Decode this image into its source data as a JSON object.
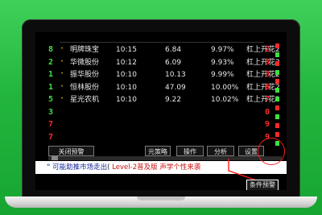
{
  "left_column": [
    "8",
    "2",
    "1",
    "1",
    "5",
    "3",
    "7",
    "7"
  ],
  "right_column": [
    "2",
    "3",
    "3",
    "6",
    "7",
    "0",
    "9",
    "9"
  ],
  "alerts": [
    {
      "name": "明牌珠宝",
      "time": "10:15",
      "price": "6.84",
      "pct": "9.97%",
      "signal": "杠上开花2"
    },
    {
      "name": "华微股份",
      "time": "10:12",
      "price": "6.09",
      "pct": "9.93%",
      "signal": "杠上开花2"
    },
    {
      "name": "振华股份",
      "time": "10:10",
      "price": "10.13",
      "pct": "9.99%",
      "signal": "杠上开花2"
    },
    {
      "name": "恒林股份",
      "time": "10:10",
      "price": "47.09",
      "pct": "10.00%",
      "signal": "杠上开花2"
    },
    {
      "name": "星光农机",
      "time": "10:10",
      "price": "9.22",
      "pct": "10.02%",
      "signal": "杠上开花2"
    }
  ],
  "toolbar": {
    "close_alert": "关闭预警",
    "tb_partial": "元策略",
    "operate": "操作",
    "analyze": "分析",
    "settings": "设置"
  },
  "ticker": {
    "quote": "\"",
    "main": "可能助推市场走出",
    "paren": "(",
    "link": "Level-2普及版",
    "rest": "声学个性来袭"
  },
  "tag": {
    "label": "条件预警"
  },
  "colors": {
    "background": "#22b53e",
    "up_arrow": "#ffd800",
    "green_digit": "#3ee03e",
    "red_digit": "#ff2a2a",
    "highlight": "#ff1a1a"
  },
  "icons": {
    "alert_row": "up-arrow-icon"
  }
}
